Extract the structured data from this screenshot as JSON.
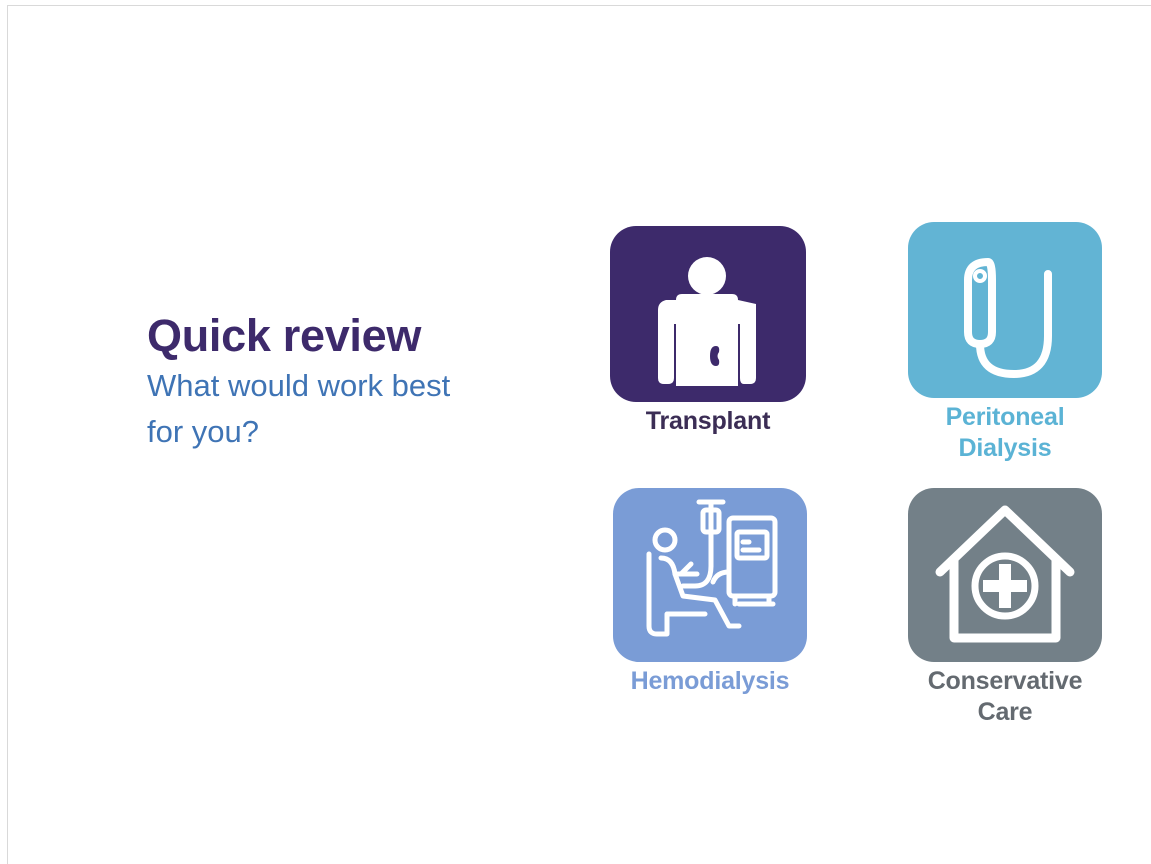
{
  "heading": {
    "title": "Quick review",
    "subtitle": "What would work best for you?"
  },
  "options": {
    "transplant": {
      "label": "Transplant",
      "icon": "person-kidney-icon",
      "color": "#3d2a6b"
    },
    "peritoneal": {
      "label_line1": "Peritoneal",
      "label_line2": "Dialysis",
      "icon": "catheter-icon",
      "color": "#62b4d4"
    },
    "hemodialysis": {
      "label": "Hemodialysis",
      "icon": "dialysis-machine-icon",
      "color": "#7a9cd6"
    },
    "conservative": {
      "label_line1": "Conservative",
      "label_line2": "Care",
      "icon": "house-medical-cross-icon",
      "color": "#738088"
    }
  }
}
